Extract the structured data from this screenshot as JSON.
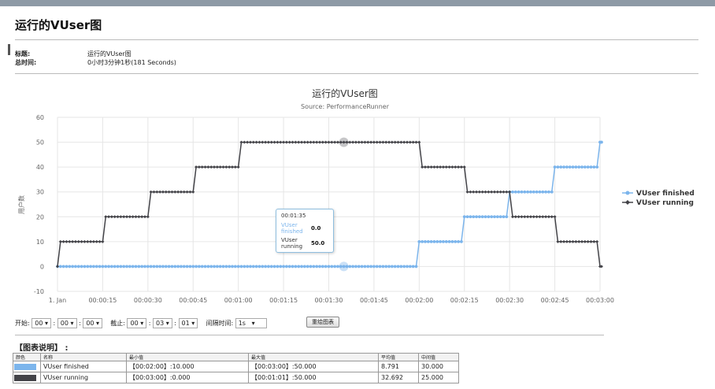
{
  "page": {
    "title": "运行的VUser图",
    "meta": [
      {
        "label": "标题:",
        "value": "运行的VUser图"
      },
      {
        "label": "总时间:",
        "value": "0小时3分钟1秒(181 Seconds)"
      }
    ]
  },
  "chart_data": {
    "type": "line",
    "title": "运行的VUser图",
    "subtitle": "Source: PerformanceRunner",
    "ylabel": "用户数",
    "ylim": [
      -10,
      60
    ],
    "yticks": [
      -10,
      0,
      10,
      20,
      30,
      40,
      50,
      60
    ],
    "xlim_seconds": [
      0,
      180
    ],
    "xticks": [
      "1. Jan",
      "00:00:15",
      "00:00:30",
      "00:00:45",
      "00:01:00",
      "00:01:15",
      "00:01:30",
      "00:01:45",
      "00:02:00",
      "00:02:15",
      "00:02:30",
      "00:02:45",
      "00:03:00"
    ],
    "grid": true,
    "legend_position": "right",
    "series": [
      {
        "name": "VUser finished",
        "color": "#7cb5ec",
        "steps": [
          {
            "t": 0,
            "v": 0
          },
          {
            "t": 120,
            "v": 10
          },
          {
            "t": 135,
            "v": 20
          },
          {
            "t": 150,
            "v": 30
          },
          {
            "t": 165,
            "v": 40
          },
          {
            "t": 180,
            "v": 50
          }
        ],
        "end_t": 181
      },
      {
        "name": "VUser running",
        "color": "#434348",
        "steps": [
          {
            "t": 0,
            "v": 0
          },
          {
            "t": 1,
            "v": 10
          },
          {
            "t": 16,
            "v": 20
          },
          {
            "t": 31,
            "v": 30
          },
          {
            "t": 46,
            "v": 40
          },
          {
            "t": 61,
            "v": 50
          },
          {
            "t": 121,
            "v": 40
          },
          {
            "t": 136,
            "v": 30
          },
          {
            "t": 151,
            "v": 20
          },
          {
            "t": 166,
            "v": 10
          },
          {
            "t": 180,
            "v": 0
          }
        ],
        "end_t": 181
      }
    ],
    "tooltip": {
      "time": "00:01:35",
      "finished_label": "VUser finished",
      "finished_value": "0.0",
      "running_label": "VUser running",
      "running_value": "50.0"
    }
  },
  "controls": {
    "start_label": "开始:",
    "start": [
      "00",
      "00",
      "00"
    ],
    "end_label": "截止:",
    "end": [
      "00",
      "03",
      "01"
    ],
    "interval_label": "间隔时间:",
    "interval": "1s",
    "redraw_button": "重绘图表"
  },
  "legend_table": {
    "title": "【图表说明】 :",
    "headers": [
      "颜色",
      "名称",
      "最小值",
      "最大值",
      "平均值",
      "中间值"
    ],
    "rows": [
      {
        "color": "#7cb5ec",
        "name": "VUser finished",
        "min": "【00:02:00】:10.000",
        "max": "【00:03:00】:50.000",
        "avg": "8.791",
        "median": "30.000"
      },
      {
        "color": "#434348",
        "name": "VUser running",
        "min": "【00:03:00】:0.000",
        "max": "【00:01:01】:50.000",
        "avg": "32.692",
        "median": "25.000"
      }
    ]
  }
}
